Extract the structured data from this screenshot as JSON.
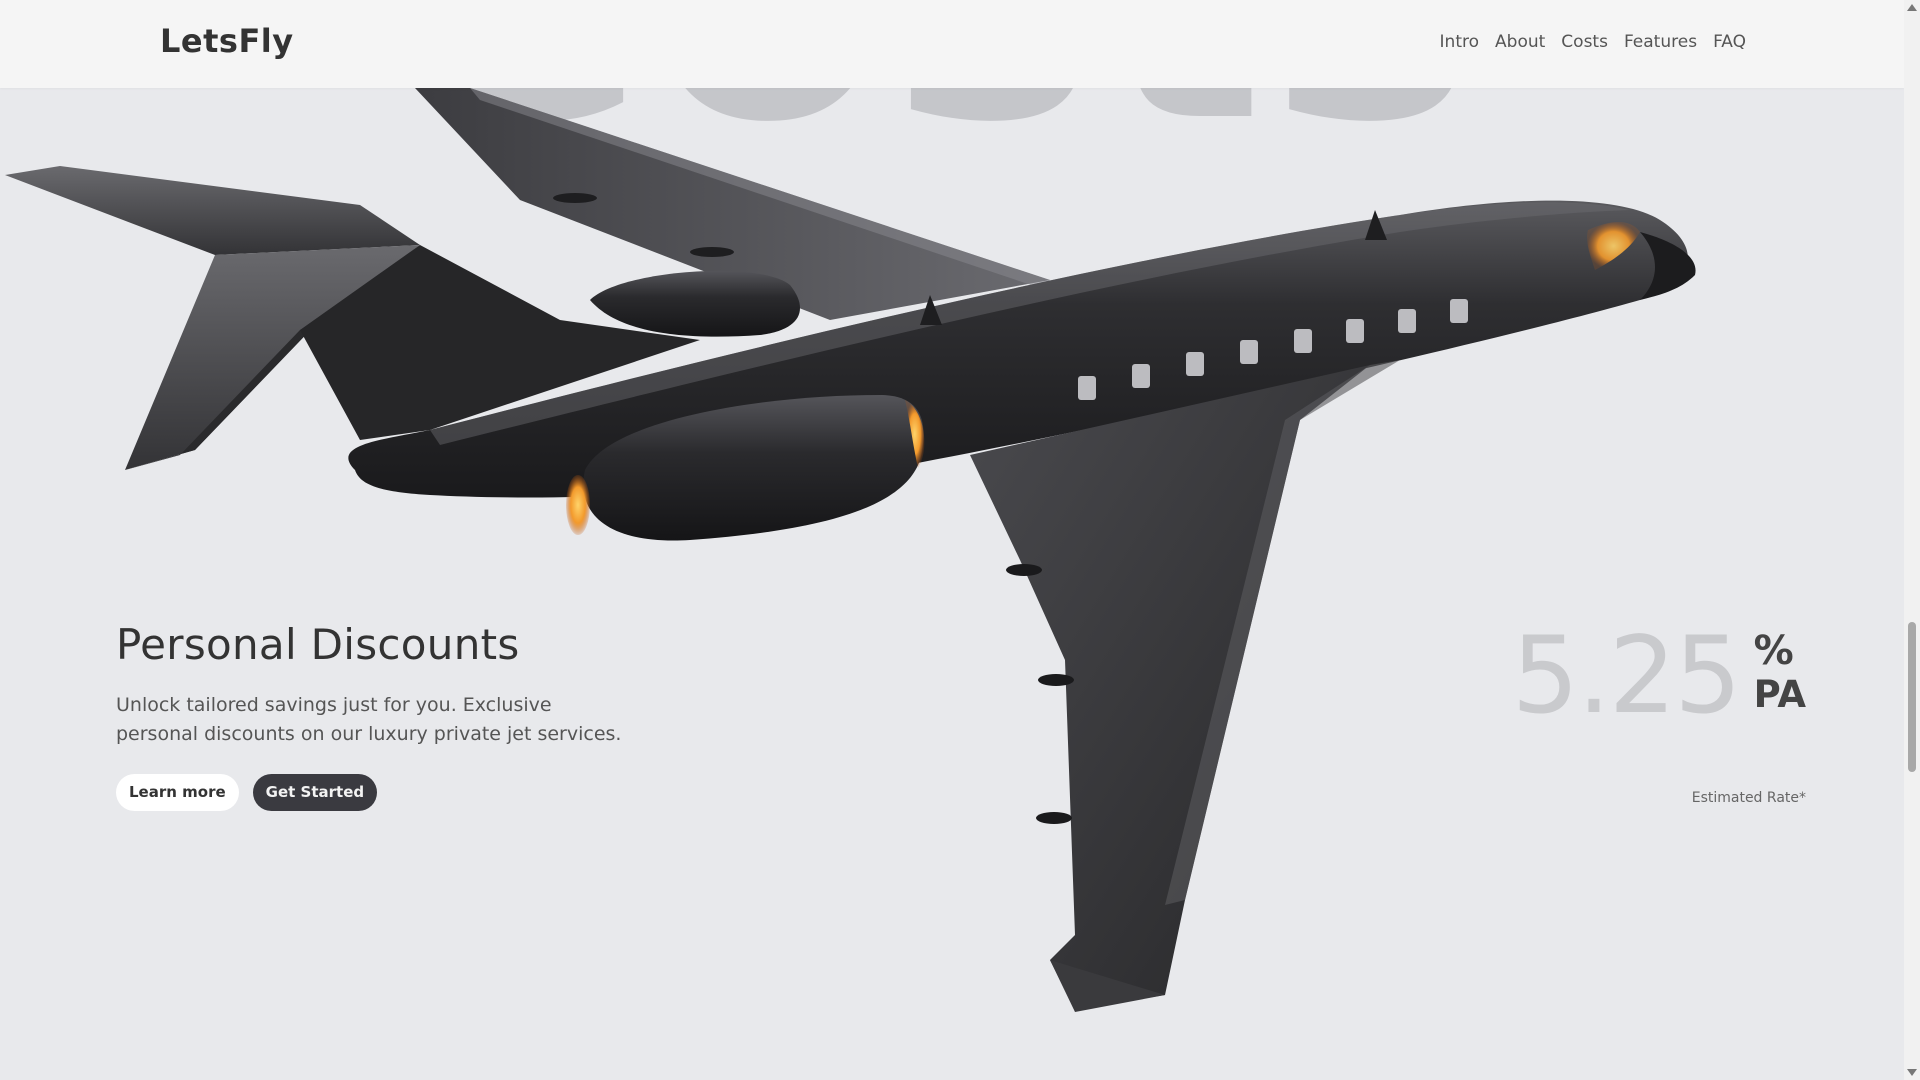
{
  "header": {
    "logo": "LetsFly",
    "nav": [
      "Intro",
      "About",
      "Costs",
      "Features",
      "FAQ"
    ]
  },
  "background_word": "Costs",
  "section": {
    "title": "Personal Discounts",
    "description": "Unlock tailored savings just for you. Exclusive personal discounts on our luxury private jet services.",
    "learn_more_label": "Learn more",
    "get_started_label": "Get Started"
  },
  "rate": {
    "value": "5.25",
    "unit_top": "%",
    "unit_bottom": "PA",
    "note": "Estimated Rate*"
  },
  "colors": {
    "background": "#e8e9ec",
    "header": "#f5f5f5",
    "dark_button": "#3a3a40",
    "plane": "#2b2b2d",
    "engine_glow": "#f39a2c"
  }
}
